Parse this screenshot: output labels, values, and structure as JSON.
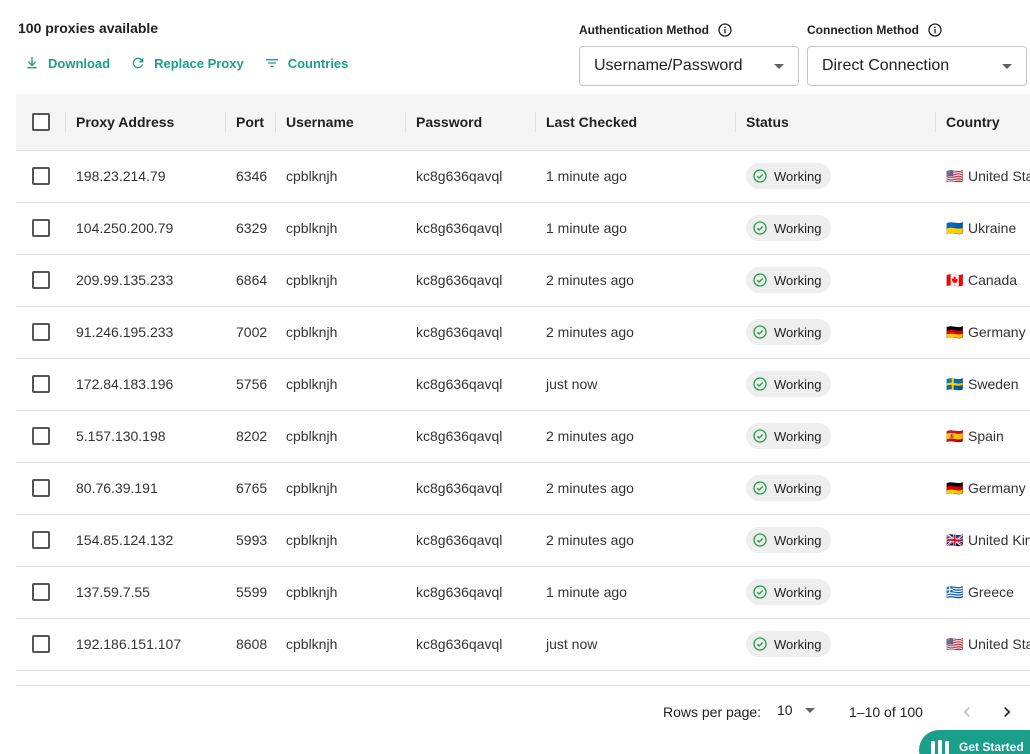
{
  "header": {
    "count_text": "100 proxies available",
    "actions": {
      "download": "Download",
      "replace": "Replace Proxy",
      "countries": "Countries"
    },
    "auth": {
      "label": "Authentication Method",
      "value": "Username/Password"
    },
    "connection": {
      "label": "Connection Method",
      "value": "Direct Connection"
    }
  },
  "table": {
    "columns": {
      "address": "Proxy Address",
      "port": "Port",
      "username": "Username",
      "password": "Password",
      "last_checked": "Last Checked",
      "status": "Status",
      "country": "Country"
    },
    "rows": [
      {
        "address": "198.23.214.79",
        "port": "6346",
        "username": "cpblknjh",
        "password": "kc8g636qavql",
        "last_checked": "1 minute ago",
        "status": "Working",
        "flag": "🇺🇸",
        "country": "United States"
      },
      {
        "address": "104.250.200.79",
        "port": "6329",
        "username": "cpblknjh",
        "password": "kc8g636qavql",
        "last_checked": "1 minute ago",
        "status": "Working",
        "flag": "🇺🇦",
        "country": "Ukraine"
      },
      {
        "address": "209.99.135.233",
        "port": "6864",
        "username": "cpblknjh",
        "password": "kc8g636qavql",
        "last_checked": "2 minutes ago",
        "status": "Working",
        "flag": "🇨🇦",
        "country": "Canada"
      },
      {
        "address": "91.246.195.233",
        "port": "7002",
        "username": "cpblknjh",
        "password": "kc8g636qavql",
        "last_checked": "2 minutes ago",
        "status": "Working",
        "flag": "🇩🇪",
        "country": "Germany"
      },
      {
        "address": "172.84.183.196",
        "port": "5756",
        "username": "cpblknjh",
        "password": "kc8g636qavql",
        "last_checked": "just now",
        "status": "Working",
        "flag": "🇸🇪",
        "country": "Sweden"
      },
      {
        "address": "5.157.130.198",
        "port": "8202",
        "username": "cpblknjh",
        "password": "kc8g636qavql",
        "last_checked": "2 minutes ago",
        "status": "Working",
        "flag": "🇪🇸",
        "country": "Spain"
      },
      {
        "address": "80.76.39.191",
        "port": "6765",
        "username": "cpblknjh",
        "password": "kc8g636qavql",
        "last_checked": "2 minutes ago",
        "status": "Working",
        "flag": "🇩🇪",
        "country": "Germany"
      },
      {
        "address": "154.85.124.132",
        "port": "5993",
        "username": "cpblknjh",
        "password": "kc8g636qavql",
        "last_checked": "2 minutes ago",
        "status": "Working",
        "flag": "🇬🇧",
        "country": "United Kingdom"
      },
      {
        "address": "137.59.7.55",
        "port": "5599",
        "username": "cpblknjh",
        "password": "kc8g636qavql",
        "last_checked": "1 minute ago",
        "status": "Working",
        "flag": "🇬🇷",
        "country": "Greece"
      },
      {
        "address": "192.186.151.107",
        "port": "8608",
        "username": "cpblknjh",
        "password": "kc8g636qavql",
        "last_checked": "just now",
        "status": "Working",
        "flag": "🇺🇸",
        "country": "United States"
      }
    ]
  },
  "pagination": {
    "rows_per_page_label": "Rows per page:",
    "rows_per_page": "10",
    "range": "1–10 of 100"
  },
  "get_started": {
    "label": "Get Started"
  },
  "colors": {
    "accent": "#1b9e8a",
    "working_green": "#2e9e4f",
    "header_bg": "#f5f5f5"
  },
  "icons": {
    "download": "download-icon",
    "replace": "refresh-icon",
    "countries": "filter-icon",
    "info": "info-icon",
    "status": "check-circle-icon",
    "prev": "chevron-left-icon",
    "next": "chevron-right-icon"
  }
}
